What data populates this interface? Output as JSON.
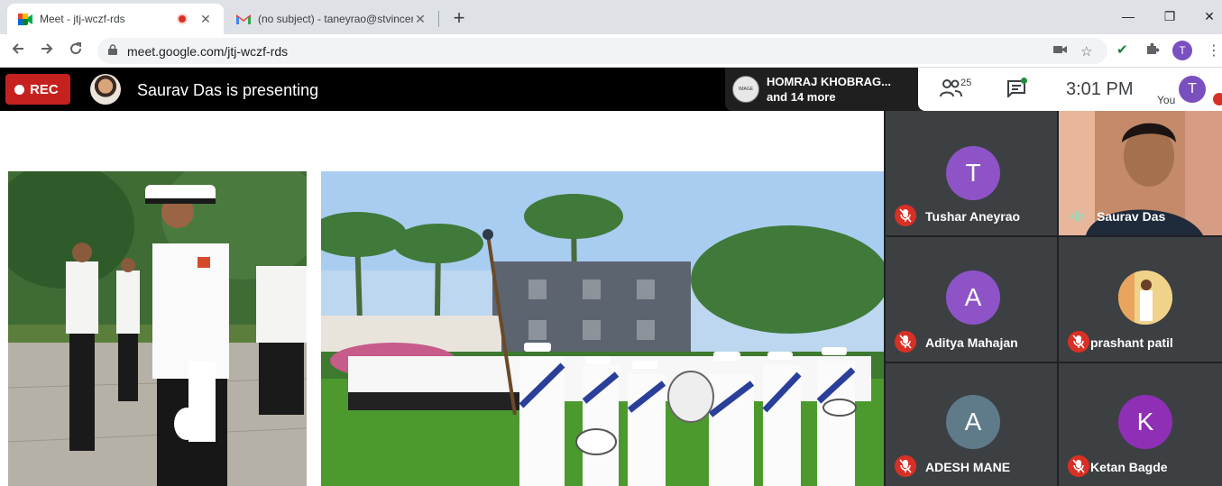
{
  "browser": {
    "tabs": [
      {
        "title": "Meet - jtj-wczf-rds",
        "close": "✕"
      },
      {
        "title": "(no subject) - taneyrao@stvincent",
        "close": "✕"
      }
    ],
    "new_tab": "+",
    "window": {
      "minimize": "—",
      "maximize": "❐",
      "close": "✕"
    },
    "url": "meet.google.com/jtj-wczf-rds",
    "profile_initial": "T"
  },
  "meet": {
    "rec_label": "REC",
    "presenting_text": "Saurav Das is presenting",
    "join_popup": {
      "name": "HOMRAJ KHOBRAG...",
      "more": "and 14 more",
      "avatar_text": "IMAGE"
    },
    "people_count": "25",
    "time": "3:01  PM",
    "you_label": "You",
    "you_initial": "T"
  },
  "participants": [
    {
      "name": "Tushar Aneyrao",
      "initial": "T",
      "color": "#8e53c6",
      "muted": true
    },
    {
      "name": "Saurav Das",
      "initial": "",
      "color": "",
      "muted": false
    },
    {
      "name": "Aditya Mahajan",
      "initial": "A",
      "color": "#8e53c6",
      "muted": true
    },
    {
      "name": "prashant patil",
      "initial": "",
      "color": "#f4c27a",
      "muted": true
    },
    {
      "name": "ADESH MANE",
      "initial": "A",
      "color": "#5f7a89",
      "muted": true
    },
    {
      "name": "Ketan Bagde",
      "initial": "K",
      "color": "#8e2fb5",
      "muted": true
    }
  ],
  "colors": {
    "rec": "#c5221f",
    "muted_mic": "#d93025",
    "tile_bg": "#3c4043",
    "accent_purple": "#8e53c6"
  }
}
